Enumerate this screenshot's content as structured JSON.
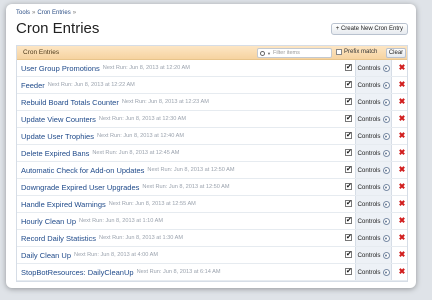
{
  "breadcrumb": [
    "Tools",
    "Cron Entries"
  ],
  "breadcrumb_sep": "»",
  "page_title": "Cron Entries",
  "create_button": "+ Create New Cron Entry",
  "list": {
    "title": "Cron Entries",
    "filter_placeholder": "Filter items",
    "prefix_label": "Prefix match",
    "clear_label": "Clear",
    "controls_label": "Controls",
    "rows": [
      {
        "name": "User Group Promotions",
        "next": "Next Run: Jun 8, 2013 at 12:20 AM"
      },
      {
        "name": "Feeder",
        "next": "Next Run: Jun 8, 2013 at 12:22 AM"
      },
      {
        "name": "Rebuild Board Totals Counter",
        "next": "Next Run: Jun 8, 2013 at 12:23 AM"
      },
      {
        "name": "Update View Counters",
        "next": "Next Run: Jun 8, 2013 at 12:30 AM"
      },
      {
        "name": "Update User Trophies",
        "next": "Next Run: Jun 8, 2013 at 12:40 AM"
      },
      {
        "name": "Delete Expired Bans",
        "next": "Next Run: Jun 8, 2013 at 12:45 AM"
      },
      {
        "name": "Automatic Check for Add-on Updates",
        "next": "Next Run: Jun 8, 2013 at 12:50 AM"
      },
      {
        "name": "Downgrade Expired User Upgrades",
        "next": "Next Run: Jun 8, 2013 at 12:50 AM"
      },
      {
        "name": "Handle Expired Warnings",
        "next": "Next Run: Jun 8, 2013 at 12:55 AM"
      },
      {
        "name": "Hourly Clean Up",
        "next": "Next Run: Jun 8, 2013 at 1:10 AM"
      },
      {
        "name": "Record Daily Statistics",
        "next": "Next Run: Jun 8, 2013 at 1:30 AM"
      },
      {
        "name": "Daily Clean Up",
        "next": "Next Run: Jun 8, 2013 at 4:00 AM"
      },
      {
        "name": "StopBotResources: DailyCleanUp",
        "next": "Next Run: Jun 8, 2013 at 6:14 AM"
      }
    ]
  }
}
